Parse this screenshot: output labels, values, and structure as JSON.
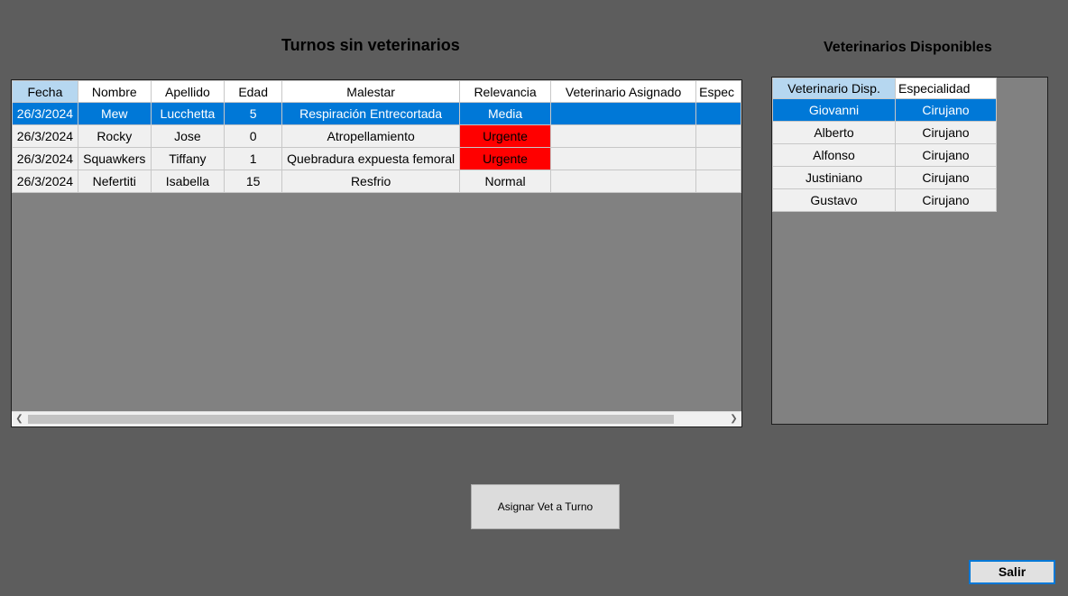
{
  "titles": {
    "pending_turns": "Turnos sin veterinarios",
    "available_vets": "Veterinarios Disponibles"
  },
  "turns_grid": {
    "columns": [
      "Fecha",
      "Nombre",
      "Apellido",
      "Edad",
      "Malestar",
      "Relevancia",
      "Veterinario Asignado",
      "Espec"
    ],
    "sorted_column": "Fecha",
    "rows": [
      {
        "fecha": "26/3/2024",
        "nombre": "Mew",
        "apellido": "Lucchetta",
        "edad": "5",
        "malestar": "Respiración Entrecortada",
        "relevancia": "Media",
        "veterinario": "",
        "espec": "",
        "selected": true
      },
      {
        "fecha": "26/3/2024",
        "nombre": "Rocky",
        "apellido": "Jose",
        "edad": "0",
        "malestar": "Atropellamiento",
        "relevancia": "Urgente",
        "veterinario": "",
        "espec": "",
        "selected": false
      },
      {
        "fecha": "26/3/2024",
        "nombre": "Squawkers",
        "apellido": "Tiffany",
        "edad": "1",
        "malestar": "Quebradura expuesta femoral",
        "relevancia": "Urgente",
        "veterinario": "",
        "espec": "",
        "selected": false
      },
      {
        "fecha": "26/3/2024",
        "nombre": "Nefertiti",
        "apellido": "Isabella",
        "edad": "15",
        "malestar": "Resfrio",
        "relevancia": "Normal",
        "veterinario": "",
        "espec": "",
        "selected": false
      }
    ],
    "scroll_left_icon": "chevron-left-icon",
    "scroll_right_icon": "chevron-right-icon"
  },
  "vets_grid": {
    "columns": [
      "Veterinario Disp.",
      "Especialidad"
    ],
    "sorted_column": "Veterinario Disp.",
    "rows": [
      {
        "nombre": "Giovanni",
        "especialidad": "Cirujano",
        "selected": true
      },
      {
        "nombre": "Alberto",
        "especialidad": "Cirujano",
        "selected": false
      },
      {
        "nombre": "Alfonso",
        "especialidad": "Cirujano",
        "selected": false
      },
      {
        "nombre": "Justiniano",
        "especialidad": "Cirujano",
        "selected": false
      },
      {
        "nombre": "Gustavo",
        "especialidad": "Cirujano",
        "selected": false
      }
    ]
  },
  "buttons": {
    "assign": "Asignar Vet a Turno",
    "exit": "Salir"
  },
  "colors": {
    "selection": "#0078d7",
    "urgent": "#ff0000",
    "sorted_header": "#b6d7f0",
    "backdrop": "#5d5d5d"
  }
}
